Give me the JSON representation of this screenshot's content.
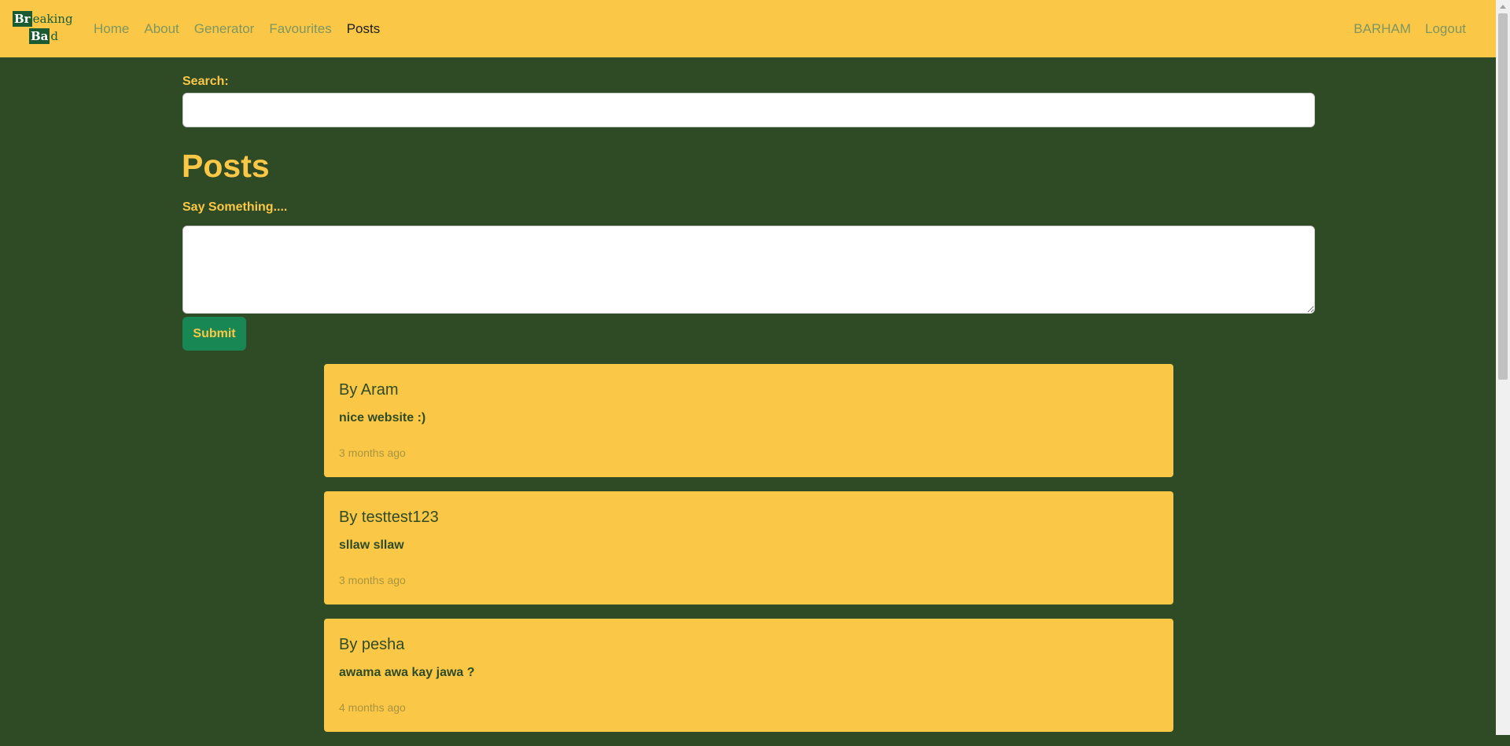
{
  "nav": {
    "brand_row1_element": "Br",
    "brand_row1_rest": "eaking",
    "brand_row2_element": "Ba",
    "brand_row2_rest": "d",
    "links": [
      {
        "label": "Home"
      },
      {
        "label": "About"
      },
      {
        "label": "Generator"
      },
      {
        "label": "Favourites"
      },
      {
        "label": "Posts"
      }
    ],
    "active": "Posts",
    "user": "BARHAM",
    "logout": "Logout"
  },
  "search": {
    "label": "Search:",
    "value": ""
  },
  "page": {
    "title": "Posts",
    "compose_label": "Say Something....",
    "compose_value": "",
    "submit_label": "Submit"
  },
  "posts": [
    {
      "author": "By Aram",
      "body": "nice website :)",
      "time": "3 months ago"
    },
    {
      "author": "By testtest123",
      "body": "sllaw sllaw",
      "time": "3 months ago"
    },
    {
      "author": "By pesha",
      "body": "awama awa kay jawa ?",
      "time": "4 months ago"
    }
  ],
  "colors": {
    "background": "#2f4b26",
    "accent": "#fac846",
    "button": "#198754",
    "brand_green": "#1a5b33"
  }
}
